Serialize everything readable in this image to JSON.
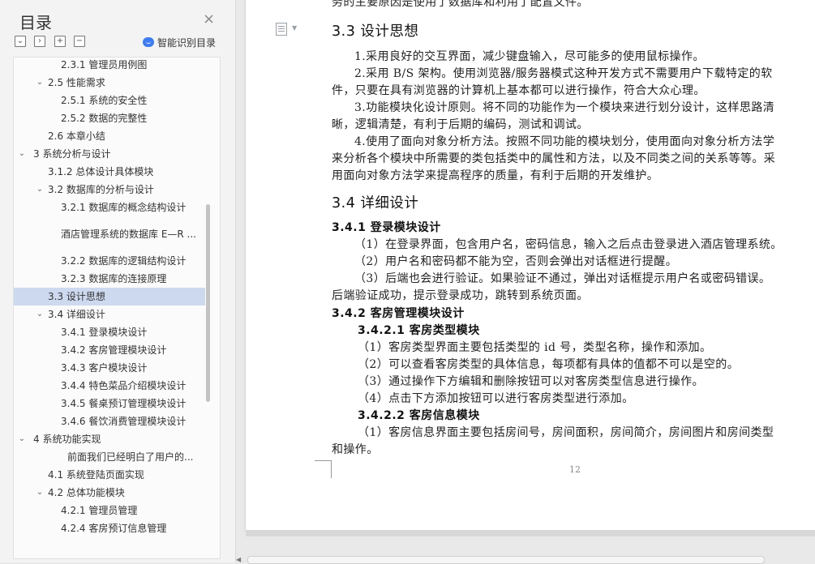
{
  "toc": {
    "title": "目录",
    "smart_label": "智能识别目录",
    "items": [
      {
        "label": "2.3.1 管理员用例图",
        "level": 3,
        "chev": ""
      },
      {
        "label": "2.5 性能需求",
        "level": 2,
        "chev": "⌄"
      },
      {
        "label": "2.5.1 系统的安全性",
        "level": 3,
        "chev": ""
      },
      {
        "label": "2.5.2 数据的完整性",
        "level": 3,
        "chev": ""
      },
      {
        "label": "2.6 本章小结",
        "level": 2,
        "chev": ""
      },
      {
        "label": "3 系统分析与设计",
        "level": 1,
        "chev": "⌄"
      },
      {
        "label": "3.1.2 总体设计具体模块",
        "level": 2,
        "chev": ""
      },
      {
        "label": "3.2 数据库的分析与设计",
        "level": 2,
        "chev": "⌄"
      },
      {
        "label": "3.2.1 数据库的概念结构设计",
        "level": 3,
        "chev": ""
      },
      {
        "label": "酒店管理系统的数据库 E—R ...",
        "level": 3,
        "chev": "",
        "gap": true
      },
      {
        "label": "3.2.2 数据库的逻辑结构设计",
        "level": 3,
        "chev": ""
      },
      {
        "label": "3.2.3 数据库的连接原理",
        "level": 3,
        "chev": ""
      },
      {
        "label": "3.3 设计思想",
        "level": 2,
        "chev": "",
        "selected": true
      },
      {
        "label": "3.4 详细设计",
        "level": 2,
        "chev": "⌄"
      },
      {
        "label": "3.4.1 登录模块设计",
        "level": 3,
        "chev": ""
      },
      {
        "label": "3.4.2 客房管理模块设计",
        "level": 3,
        "chev": ""
      },
      {
        "label": "3.4.3 客户模块设计",
        "level": 3,
        "chev": ""
      },
      {
        "label": "3.4.4 特色菜品介绍模块设计",
        "level": 3,
        "chev": ""
      },
      {
        "label": "3.4.5 餐桌预订管理模块设计",
        "level": 3,
        "chev": ""
      },
      {
        "label": "3.4.6 餐饮消费管理模块设计",
        "level": 3,
        "chev": ""
      },
      {
        "label": "4 系统功能实现",
        "level": 1,
        "chev": "⌄"
      },
      {
        "label": "前面我们已经明白了用户的...",
        "level": 4,
        "chev": ""
      },
      {
        "label": "4.1 系统登陆页面实现",
        "level": 2,
        "chev": ""
      },
      {
        "label": "4.2 总体功能模块",
        "level": 2,
        "chev": "⌄"
      },
      {
        "label": "4.2.1 管理员管理",
        "level": 3,
        "chev": ""
      },
      {
        "label": "4.2.4 客房预订信息管理",
        "level": 3,
        "chev": ""
      }
    ]
  },
  "doc": {
    "top_line": "务的主要原因是使用了数据库和利用了配置文件。",
    "h_33": "3.3 设计思想",
    "p1": "1.采用良好的交互界面，减少键盘输入，尽可能多的使用鼠标操作。",
    "p2a": "2.采用 B/S 架构。使用浏览器/服务器模式这种开发方式不需要用户下载特定的软",
    "p2b": "件，只要在具有浏览器的计算机上基本都可以进行操作，符合大众心理。",
    "p3a": "3.功能模块化设计原则。将不同的功能作为一个模块来进行划分设计，这样思路清",
    "p3b": "晰，逻辑清楚，有利于后期的编码，测试和调试。",
    "p4a": "4.使用了面向对象分析方法。按照不同功能的模块划分，使用面向对象分析方法学",
    "p4b": "来分析各个模块中所需要的类包括类中的属性和方法，以及不同类之间的关系等等。采",
    "p4c": "用面向对象方法学来提高程序的质量，有利于后期的开发维护。",
    "h_34": "3.4 详细设计",
    "h_341": "3.4.1 登录模块设计",
    "l1": "（1）在登录界面，包含用户名，密码信息，输入之后点击登录进入酒店管理系统。",
    "l2": "（2）用户名和密码都不能为空，否则会弹出对话框进行提醒。",
    "l3a": "（3）后端也会进行验证。如果验证不通过，弹出对话框提示用户名或密码错误。",
    "l3b": "后端验证成功，提示登录成功，跳转到系统页面。",
    "h_342": "3.4.2 客房管理模块设计",
    "h_3421": "3.4.2.1 客房类型模块",
    "k1": "（1）客房类型界面主要包括类型的 id 号，类型名称，操作和添加。",
    "k2": "（2）可以查看客房类型的具体信息，每项都有具体的值都不可以是空的。",
    "k3": "（3）通过操作下方编辑和删除按钮可以对客房类型信息进行操作。",
    "k4": "（4）点击下方添加按钮可以进行客房类型进行添加。",
    "h_3422": "3.4.2.2 客房信息模块",
    "m1a": "（1）客房信息界面主要包括房间号，房间面积，房间简介，房间图片和房间类型",
    "m1b": "和操作。",
    "page_number": "12"
  }
}
